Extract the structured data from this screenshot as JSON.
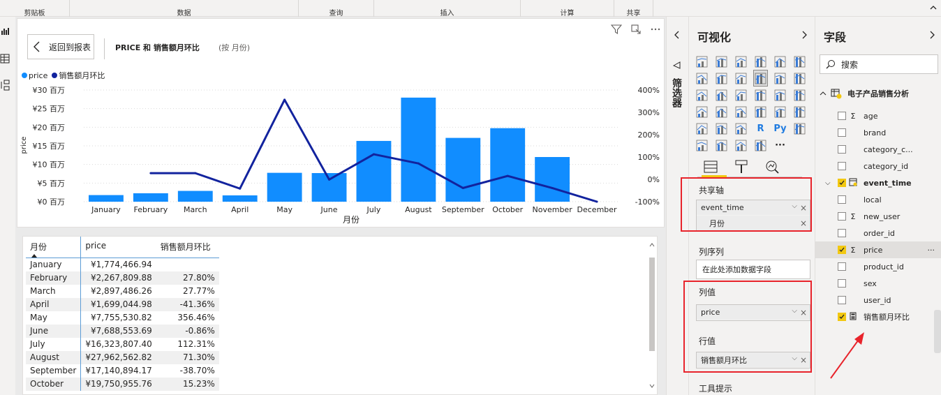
{
  "ribbon": {
    "groups": [
      "剪贴板",
      "数据",
      "查询",
      "插入",
      "计算",
      "共享"
    ]
  },
  "visual": {
    "back_label": "返回到报表",
    "title": "PRICE 和 销售额月环比",
    "subtitle": "(按 月份)",
    "legend": [
      {
        "name": "price",
        "color": "#118dff"
      },
      {
        "name": "销售额月环比",
        "color": "#12239e"
      }
    ]
  },
  "chart_data": {
    "type": "bar",
    "categories": [
      "January",
      "February",
      "March",
      "April",
      "May",
      "June",
      "July",
      "August",
      "September",
      "October",
      "November",
      "December"
    ],
    "series": [
      {
        "name": "price",
        "type": "bar",
        "axis": "left",
        "values": [
          1774466.94,
          2267809.88,
          2897486.26,
          1699044.98,
          7755530.82,
          7688553.69,
          16323807.4,
          27962562.82,
          17140894.17,
          19750955.76,
          12000000,
          null
        ]
      },
      {
        "name": "销售额月环比",
        "type": "line",
        "axis": "right",
        "values": [
          null,
          27.8,
          27.77,
          -41.36,
          356.46,
          -0.86,
          112.31,
          71.3,
          -38.7,
          15.23,
          -39,
          -100
        ]
      }
    ],
    "left_ticks": [
      "¥30 百万",
      "¥25 百万",
      "¥20 百万",
      "¥15 百万",
      "¥10 百万",
      "¥5 百万",
      "¥0 百万"
    ],
    "right_ticks": [
      "400%",
      "300%",
      "200%",
      "100%",
      "0%",
      "-100%"
    ],
    "ylim_left": [
      0,
      30000000
    ],
    "ylim_right": [
      -100,
      400
    ],
    "xlabel": "月份",
    "ylabel": "price",
    "colors": {
      "bar": "#118dff",
      "line": "#12239e"
    },
    "grid": true
  },
  "table": {
    "headers": [
      "月份",
      "price",
      "销售额月环比"
    ],
    "rows": [
      [
        "January",
        "¥1,774,466.94",
        ""
      ],
      [
        "February",
        "¥2,267,809.88",
        "27.80%"
      ],
      [
        "March",
        "¥2,897,486.26",
        "27.77%"
      ],
      [
        "April",
        "¥1,699,044.98",
        "-41.36%"
      ],
      [
        "May",
        "¥7,755,530.82",
        "356.46%"
      ],
      [
        "June",
        "¥7,688,553.69",
        "-0.86%"
      ],
      [
        "July",
        "¥16,323,807.40",
        "112.31%"
      ],
      [
        "August",
        "¥27,962,562.82",
        "71.30%"
      ],
      [
        "September",
        "¥17,140,894.17",
        "-38.70%"
      ],
      [
        "October",
        "¥19,750,955.76",
        "15.23%"
      ]
    ]
  },
  "filter_pane": {
    "label": "筛选器"
  },
  "viz_pane": {
    "title": "可视化",
    "wells": {
      "shared_axis": {
        "label": "共享轴",
        "fields": [
          "event_time",
          "月份"
        ]
      },
      "column_series": {
        "label": "列序列",
        "placeholder": "在此处添加数据字段"
      },
      "column_values": {
        "label": "列值",
        "fields": [
          "price"
        ]
      },
      "line_values": {
        "label": "行值",
        "fields": [
          "销售额月环比"
        ]
      },
      "tooltips": {
        "label": "工具提示"
      }
    }
  },
  "fields_pane": {
    "title": "字段",
    "search_placeholder": "搜索",
    "table_name": "电子产品销售分析",
    "fields": [
      {
        "name": "age",
        "type": "Σ",
        "checked": false
      },
      {
        "name": "brand",
        "type": "",
        "checked": false
      },
      {
        "name": "category_c...",
        "type": "",
        "checked": false
      },
      {
        "name": "category_id",
        "type": "",
        "checked": false
      },
      {
        "name": "event_time",
        "type": "hierarchy",
        "checked": true
      },
      {
        "name": "local",
        "type": "",
        "checked": false
      },
      {
        "name": "new_user",
        "type": "Σ",
        "checked": false
      },
      {
        "name": "order_id",
        "type": "",
        "checked": false
      },
      {
        "name": "price",
        "type": "Σ",
        "checked": true
      },
      {
        "name": "product_id",
        "type": "",
        "checked": false
      },
      {
        "name": "sex",
        "type": "",
        "checked": false
      },
      {
        "name": "user_id",
        "type": "",
        "checked": false
      },
      {
        "name": "销售额月环比",
        "type": "measure",
        "checked": true
      }
    ]
  }
}
